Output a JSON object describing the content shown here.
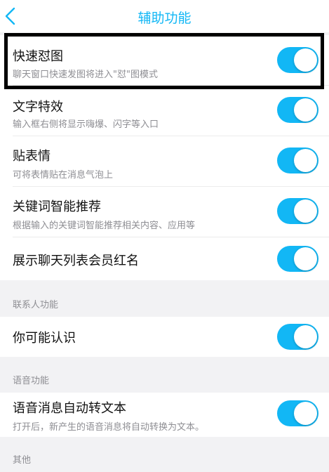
{
  "nav": {
    "title": "辅助功能",
    "back_icon": "chevron-left-icon",
    "accent": "#12b7f5"
  },
  "group1": [
    {
      "title": "快速怼图",
      "subtitle": "聊天窗口快速发图将进入\"怼\"图模式",
      "enabled": true
    },
    {
      "title": "文字特效",
      "subtitle": "输入框右侧将显示嗨爆、闪字等入口",
      "enabled": true
    },
    {
      "title": "贴表情",
      "subtitle": "可将表情贴在消息气泡上",
      "enabled": true
    },
    {
      "title": "关键词智能推荐",
      "subtitle": "根据输入的关键词智能推荐相关内容、应用等",
      "enabled": true
    },
    {
      "title": "展示聊天列表会员红名",
      "enabled": true
    }
  ],
  "sections": {
    "contacts": {
      "label": "联系人功能",
      "items": [
        {
          "title": "你可能认识",
          "enabled": true
        }
      ]
    },
    "voice": {
      "label": "语音功能",
      "items": [
        {
          "title": "语音消息自动转文本",
          "subtitle": "打开后，新产生的语音消息将自动转换为文本。",
          "enabled": true
        }
      ]
    },
    "other": {
      "label": "其他"
    }
  },
  "toggle_on_color": "#12b7f5"
}
